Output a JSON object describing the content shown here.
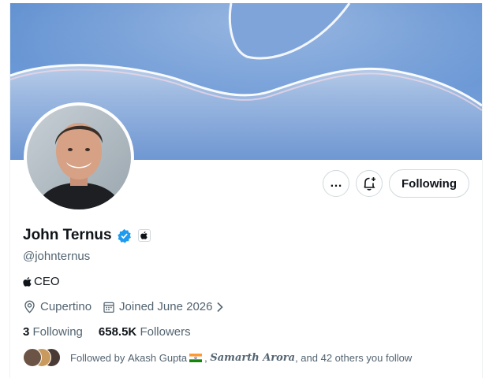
{
  "profile": {
    "name": "John Ternus",
    "handle": "@johnternus",
    "bio_text": "CEO",
    "location": "Cupertino",
    "joined": "Joined June 2026",
    "following_count": "3",
    "following_label": "Following",
    "followers_count": "658.5K",
    "followers_label": "Followers"
  },
  "actions": {
    "more_label": "…",
    "follow_label": "Following"
  },
  "followed_by": {
    "prefix": "Followed by ",
    "user1": "Akash Gupta",
    "user2": "Samarth Arora",
    "suffix": ", and 42 others you follow"
  },
  "icons": {
    "verified": "verified-badge-icon",
    "affiliate": "apple-logo-icon",
    "location": "location-pin-icon",
    "calendar": "calendar-icon",
    "notify": "bell-plus-icon",
    "more": "more-dots-icon"
  },
  "colors": {
    "verified_blue": "#1d9bf0",
    "banner_blue": "#6f9bd6",
    "text_primary": "#0f1419",
    "text_secondary": "#536471"
  }
}
